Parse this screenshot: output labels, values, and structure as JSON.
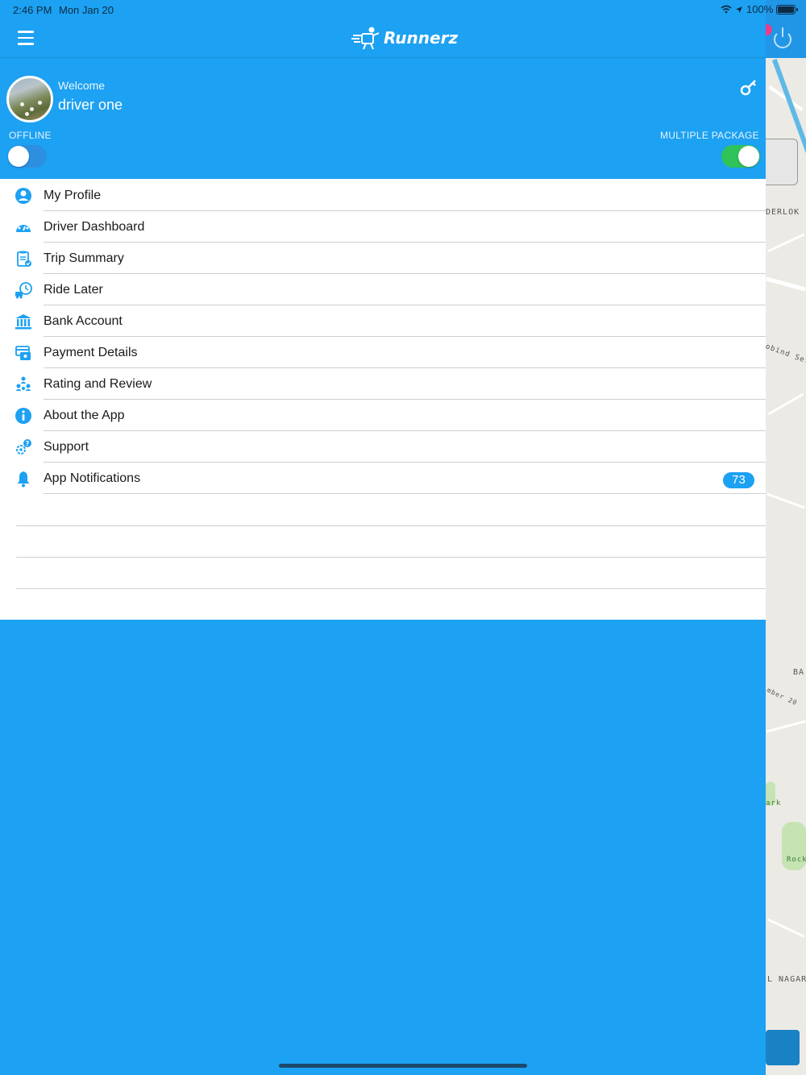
{
  "status_bar": {
    "time": "2:46 PM",
    "date": "Mon Jan 20",
    "battery": "100%"
  },
  "navbar": {
    "app_name": "Runnerz"
  },
  "profile": {
    "welcome": "Welcome",
    "name": "driver one",
    "offline_label": "OFFLINE",
    "multiple_package_label": "MULTIPLE PACKAGE",
    "offline_toggle_on": false,
    "multiple_package_toggle_on": true
  },
  "menu": {
    "items": [
      {
        "label": "My Profile",
        "icon": "user-icon"
      },
      {
        "label": "Driver Dashboard",
        "icon": "dashboard-icon"
      },
      {
        "label": "Trip Summary",
        "icon": "clipboard-icon"
      },
      {
        "label": "Ride Later",
        "icon": "clock-truck-icon"
      },
      {
        "label": "Bank Account",
        "icon": "bank-icon"
      },
      {
        "label": "Payment Details",
        "icon": "payment-icon"
      },
      {
        "label": "Rating and Review",
        "icon": "people-icon"
      },
      {
        "label": "About the App",
        "icon": "info-icon"
      },
      {
        "label": "Support",
        "icon": "support-icon"
      },
      {
        "label": "App Notifications",
        "icon": "bell-icon",
        "badge": "73"
      }
    ]
  },
  "map": {
    "labels": [
      "DERLOK",
      "obind Setu",
      "BA",
      "mber 20",
      "ark",
      "Rock",
      "L NAGAR"
    ]
  },
  "colors": {
    "primary": "#1da1f2",
    "toggle_on": "#2fc35a",
    "map_bg": "#eceae4"
  }
}
